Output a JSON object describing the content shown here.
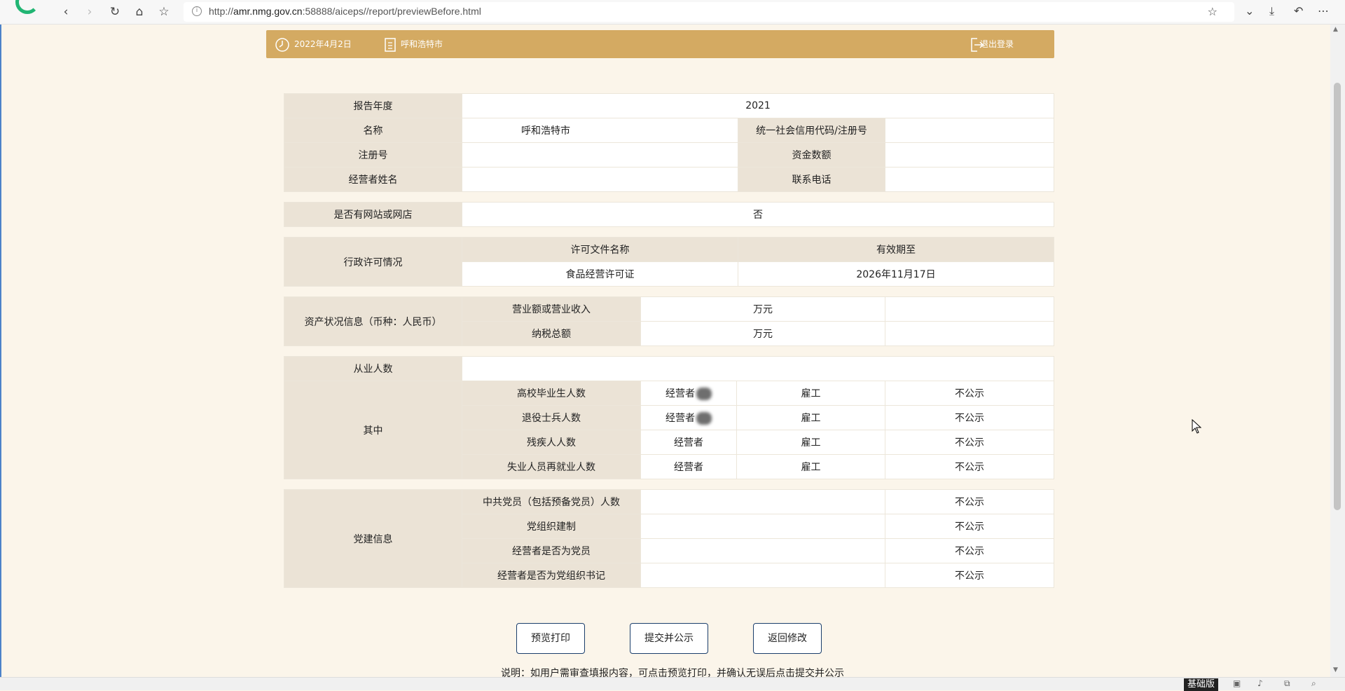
{
  "browser": {
    "url_prefix": "http://",
    "url_host": "amr.nmg.gov.cn",
    "url_rest": ":58888/aiceps//report/previewBefore.html",
    "icons": [
      "back-icon",
      "forward-icon",
      "reload-icon",
      "home-icon",
      "bookmark-icon",
      "info-icon",
      "star-icon",
      "chevron-down-icon",
      "download-icon",
      "undo-icon",
      "more-icon"
    ]
  },
  "header": {
    "date": "2022年4月2日",
    "region": "呼和浩特市",
    "logout": "退出登录",
    "accent": "#d4aa62"
  },
  "report": {
    "year_label": "报告年度",
    "year_value": "2021",
    "name_label": "名称",
    "name_value": "呼和浩特市",
    "credit_code_label": "统一社会信用代码/注册号",
    "reg_no_label": "注册号",
    "capital_label": "资金数额",
    "operator_label": "经营者姓名",
    "phone_label": "联系电话",
    "website_label": "是否有网站或网店",
    "website_value": "否",
    "license_section": "行政许可情况",
    "license_name_header": "许可文件名称",
    "license_valid_header": "有效期至",
    "license_name": "食品经营许可证",
    "license_valid": "2026年11月17日",
    "assets_section": "资产状况信息（币种：人民币）",
    "revenue_label": "营业额或营业收入",
    "revenue_unit": "万元",
    "tax_label": "纳税总额",
    "tax_unit": "万元",
    "employees_label": "从业人数",
    "among_label": "其中",
    "employee_rows": [
      {
        "label": "高校毕业生人数",
        "operator": "经营者",
        "employee": "雇工",
        "status": "不公示"
      },
      {
        "label": "退役士兵人数",
        "operator": "经营者",
        "employee": "雇工",
        "status": "不公示"
      },
      {
        "label": "残疾人人数",
        "operator": "经营者",
        "employee": "雇工",
        "status": "不公示"
      },
      {
        "label": "失业人员再就业人数",
        "operator": "经营者",
        "employee": "雇工",
        "status": "不公示"
      }
    ],
    "party_section": "党建信息",
    "party_rows": [
      {
        "label": "中共党员（包括预备党员）人数",
        "status": "不公示"
      },
      {
        "label": "党组织建制",
        "status": "不公示"
      },
      {
        "label": "经营者是否为党员",
        "status": "不公示"
      },
      {
        "label": "经营者是否为党组织书记",
        "status": "不公示"
      }
    ]
  },
  "actions": {
    "preview_print": "预览打印",
    "submit_publish": "提交并公示",
    "back_edit": "返回修改",
    "border_color": "#1b3e6b"
  },
  "note": "说明：如用户需审查填报内容，可点击预览打印，并确认无误后点击提交并公示",
  "statusbar": {
    "edition": "基础版"
  }
}
